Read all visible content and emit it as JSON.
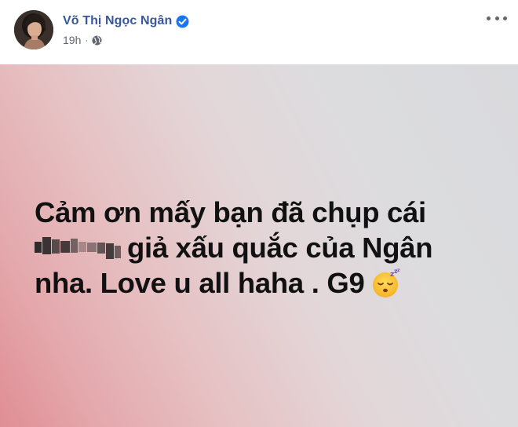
{
  "post": {
    "author": "Võ Thị Ngọc Ngân",
    "time": "19h",
    "separator": "·",
    "audience_icon": "globe-icon",
    "verified_icon": "verified-badge-icon",
    "more_icon": "more-options-icon"
  },
  "content": {
    "line1": "Cảm ơn mấy bạn đã chụp cái",
    "line2_after_blur": "giả xấu quắc của Ngân",
    "line3": "nha. Love u all haha . G9",
    "emoji": "sleeping-face-emoji"
  },
  "colors": {
    "name": "#385898",
    "verified": "#1877f2",
    "meta": "#616770",
    "bg_left": "#df8e94",
    "bg_right": "#d9dadd"
  }
}
